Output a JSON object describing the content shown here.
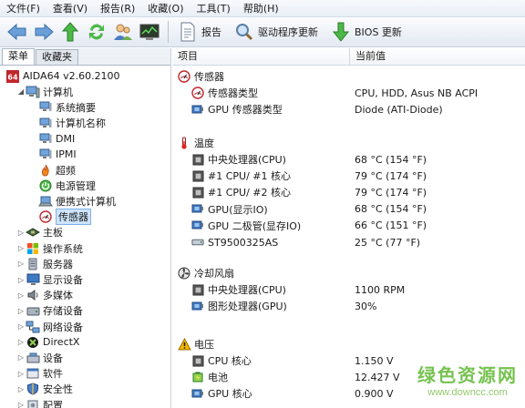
{
  "menubar": {
    "items": [
      {
        "label": "文件(F)"
      },
      {
        "label": "查看(V)"
      },
      {
        "label": "报告(R)"
      },
      {
        "label": "收藏(O)"
      },
      {
        "label": "工具(T)"
      },
      {
        "label": "帮助(H)"
      }
    ]
  },
  "toolbar": {
    "report_label": "报告",
    "driver_update_label": "驱动程序更新",
    "bios_update_label": "BIOS 更新"
  },
  "left_panel": {
    "tabs": [
      {
        "label": "菜单",
        "active": true
      },
      {
        "label": "收藏夹",
        "active": false
      }
    ],
    "tree": [
      {
        "label": "AIDA64 v2.60.2100",
        "level": 0,
        "expand": "none",
        "icon": "aida64-logo-icon"
      },
      {
        "label": "计算机",
        "level": 1,
        "expand": "expanded",
        "icon": "computer-icon"
      },
      {
        "label": "系统摘要",
        "level": 2,
        "expand": "none",
        "icon": "computer-small-icon"
      },
      {
        "label": "计算机名称",
        "level": 2,
        "expand": "none",
        "icon": "computer-small-icon"
      },
      {
        "label": "DMI",
        "level": 2,
        "expand": "none",
        "icon": "computer-small-icon"
      },
      {
        "label": "IPMI",
        "level": 2,
        "expand": "none",
        "icon": "computer-small-icon"
      },
      {
        "label": "超频",
        "level": 2,
        "expand": "none",
        "icon": "flame-icon"
      },
      {
        "label": "电源管理",
        "level": 2,
        "expand": "none",
        "icon": "power-icon"
      },
      {
        "label": "便携式计算机",
        "level": 2,
        "expand": "none",
        "icon": "laptop-icon"
      },
      {
        "label": "传感器",
        "level": 2,
        "expand": "none",
        "icon": "sensor-gauge-icon",
        "selected": true
      },
      {
        "label": "主板",
        "level": 1,
        "expand": "collapsed",
        "icon": "motherboard-icon"
      },
      {
        "label": "操作系统",
        "level": 1,
        "expand": "collapsed",
        "icon": "windows-logo-icon"
      },
      {
        "label": "服务器",
        "level": 1,
        "expand": "collapsed",
        "icon": "server-icon"
      },
      {
        "label": "显示设备",
        "level": 1,
        "expand": "collapsed",
        "icon": "monitor-icon"
      },
      {
        "label": "多媒体",
        "level": 1,
        "expand": "collapsed",
        "icon": "speaker-icon"
      },
      {
        "label": "存储设备",
        "level": 1,
        "expand": "collapsed",
        "icon": "storage-icon"
      },
      {
        "label": "网络设备",
        "level": 1,
        "expand": "collapsed",
        "icon": "network-icon"
      },
      {
        "label": "DirectX",
        "level": 1,
        "expand": "collapsed",
        "icon": "directx-icon"
      },
      {
        "label": "设备",
        "level": 1,
        "expand": "collapsed",
        "icon": "devices-icon"
      },
      {
        "label": "软件",
        "level": 1,
        "expand": "collapsed",
        "icon": "software-icon"
      },
      {
        "label": "安全性",
        "level": 1,
        "expand": "collapsed",
        "icon": "shield-icon"
      },
      {
        "label": "配置",
        "level": 1,
        "expand": "collapsed",
        "icon": "config-icon"
      }
    ]
  },
  "right_panel": {
    "column_headers": [
      "项目",
      "当前值"
    ],
    "groups": [
      {
        "title": "传感器",
        "icon": "sensor-gauge-icon",
        "items": [
          {
            "label": "传感器类型",
            "value": "CPU, HDD, Asus NB ACPI",
            "icon": "sensor-gauge-icon"
          },
          {
            "label": "GPU 传感器类型",
            "value": "Diode  (ATI-Diode)",
            "icon": "gpu-chip-icon"
          }
        ]
      },
      {
        "title": "温度",
        "icon": "thermometer-icon",
        "items": [
          {
            "label": "中央处理器(CPU)",
            "value": "68 °C  (154 °F)",
            "icon": "cpu-chip-icon"
          },
          {
            "label": "#1 CPU/ #1 核心",
            "value": "79 °C  (174 °F)",
            "icon": "cpu-chip-icon"
          },
          {
            "label": "#1 CPU/ #2 核心",
            "value": "79 °C  (174 °F)",
            "icon": "cpu-chip-icon"
          },
          {
            "label": "GPU(显示IO)",
            "value": "68 °C  (154 °F)",
            "icon": "gpu-chip-icon"
          },
          {
            "label": "GPU 二极管(显存IO)",
            "value": "66 °C  (151 °F)",
            "icon": "gpu-chip-icon"
          },
          {
            "label": "ST9500325AS",
            "value": "25 °C  (77 °F)",
            "icon": "hard-drive-icon"
          }
        ]
      },
      {
        "title": "冷却风扇",
        "icon": "fan-icon",
        "items": [
          {
            "label": "中央处理器(CPU)",
            "value": "1100 RPM",
            "icon": "cpu-chip-icon"
          },
          {
            "label": "图形处理器(GPU)",
            "value": "30%",
            "icon": "gpu-chip-icon"
          }
        ]
      },
      {
        "title": "电压",
        "icon": "warning-icon",
        "items": [
          {
            "label": "CPU 核心",
            "value": "1.150 V",
            "icon": "cpu-chip-icon"
          },
          {
            "label": "电池",
            "value": "12.427 V",
            "icon": "battery-icon"
          },
          {
            "label": "GPU 核心",
            "value": "0.900 V",
            "icon": "gpu-chip-icon"
          }
        ]
      }
    ]
  },
  "watermark": {
    "title": "绿色资源网",
    "url": "www.downcc.com"
  }
}
